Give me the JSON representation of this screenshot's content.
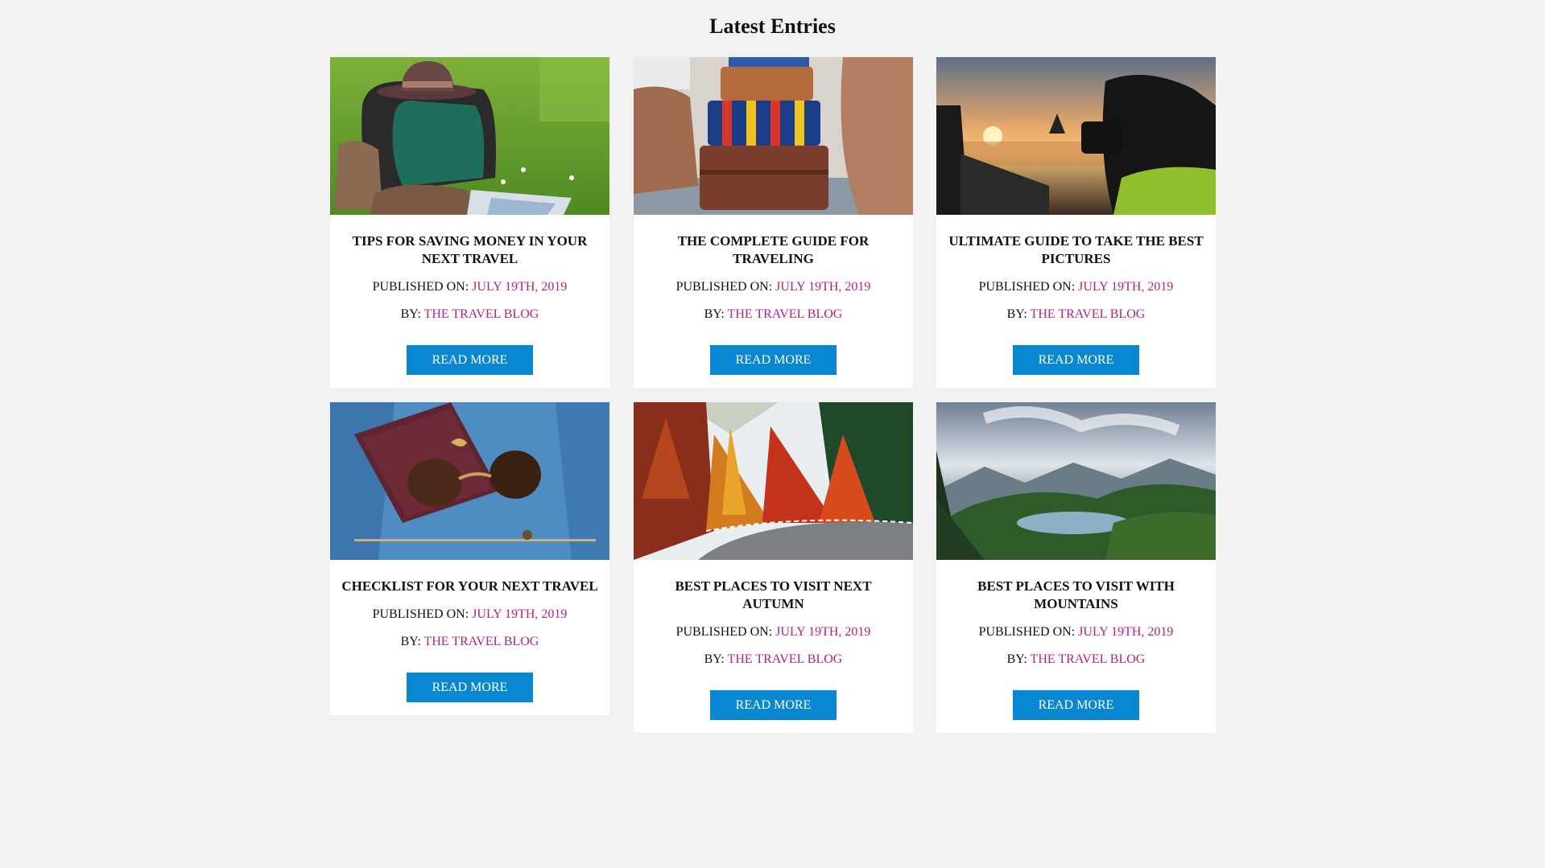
{
  "header": {
    "title": "Latest Entries"
  },
  "labels": {
    "published_on": "PUBLISHED ON: ",
    "by": "BY: "
  },
  "colors": {
    "accent": "#b0237f",
    "button": "#0a87d1",
    "background": "#f2f2f2"
  },
  "entries": [
    {
      "title": "TIPS FOR SAVING MONEY IN YOUR NEXT TRAVEL",
      "date": "JULY 19TH, 2019",
      "author": "THE TRAVEL BLOG",
      "button": "READ MORE",
      "image": "backpack-hat-boots-on-grass"
    },
    {
      "title": "THE COMPLETE GUIDE FOR TRAVELING",
      "date": "JULY 19TH, 2019",
      "author": "THE TRAVEL BLOG",
      "button": "READ MORE",
      "image": "stacked-suitcases"
    },
    {
      "title": "ULTIMATE GUIDE TO TAKE THE BEST PICTURES",
      "date": "JULY 19TH, 2019",
      "author": "THE TRAVEL BLOG",
      "button": "READ MORE",
      "image": "photographer-sunset-river"
    },
    {
      "title": "CHECKLIST FOR YOUR NEXT TRAVEL",
      "date": "JULY 19TH, 2019",
      "author": "THE TRAVEL BLOG",
      "button": "READ MORE",
      "image": "passport-sunglasses-denim"
    },
    {
      "title": "BEST PLACES TO VISIT NEXT AUTUMN",
      "date": "JULY 19TH, 2019",
      "author": "THE TRAVEL BLOG",
      "button": "READ MORE",
      "image": "autumn-forest-road"
    },
    {
      "title": "BEST PLACES TO VISIT WITH MOUNTAINS",
      "date": "JULY 19TH, 2019",
      "author": "THE TRAVEL BLOG",
      "button": "READ MORE",
      "image": "mountain-lake-landscape"
    }
  ]
}
